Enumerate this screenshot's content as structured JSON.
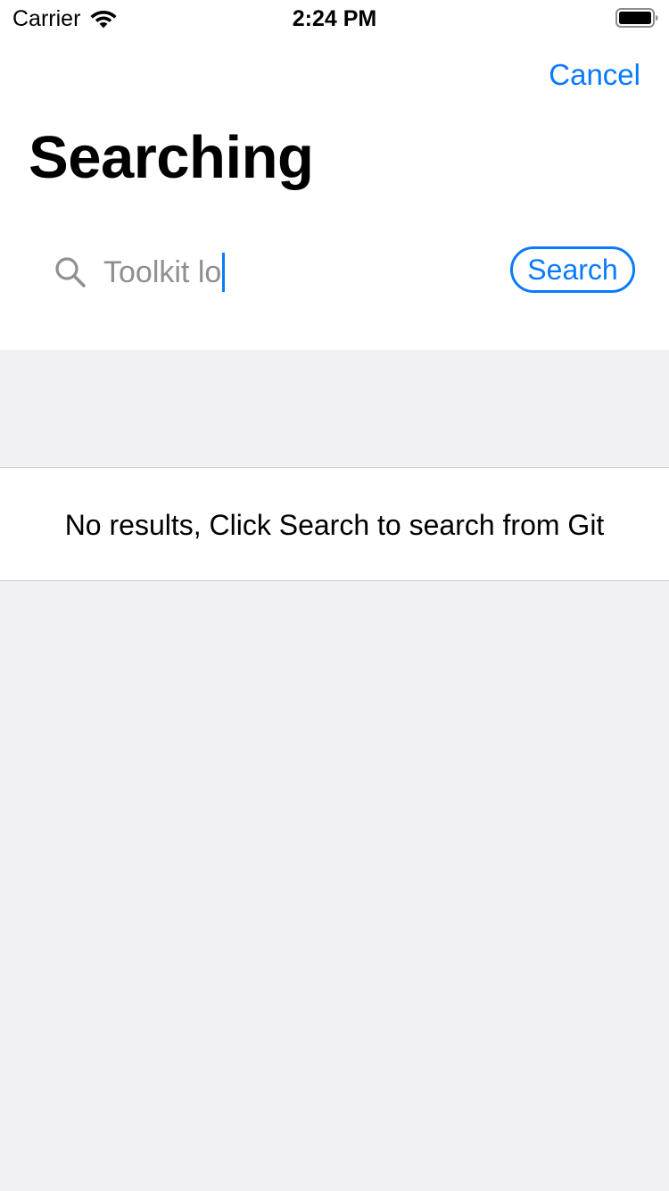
{
  "status_bar": {
    "carrier": "Carrier",
    "time": "2:24 PM"
  },
  "nav": {
    "cancel_label": "Cancel",
    "title": "Searching"
  },
  "search": {
    "value": "Toolkit lo",
    "button_label": "Search"
  },
  "results": {
    "empty_message": "No results, Click Search to search from Git"
  },
  "colors": {
    "accent": "#0A7AFF",
    "background": "#F0F0F5",
    "placeholder_text": "#8E8E93"
  },
  "icons": {
    "wifi": "wifi-icon",
    "battery": "battery-icon",
    "search": "search-icon"
  }
}
